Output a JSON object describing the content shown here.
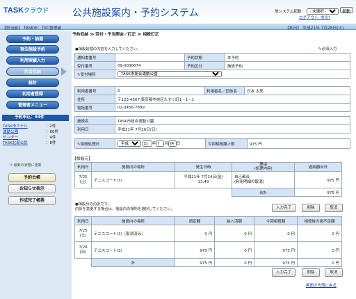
{
  "header": {
    "logo_main": "TASK",
    "logo_sub": "クラウド",
    "app_title": "公共施設案内・予約システム",
    "system_label": "他システム起動：",
    "system_select": "- 未選択 -",
    "launch": "起動",
    "logout": "ログアウト",
    "help": "市の?"
  },
  "topbar": {
    "left": "【担当者】 TASK市：TKC管理者",
    "right": "【本日】 平成21年 7月28日(火)"
  },
  "breadcrumb": "予約収納 ≫ 受付・予当照会／訂正 ≫ 相殺訂正",
  "nav": [
    "予約・抽選",
    "宿泊施設予約",
    "利用実績入力",
    "料金収納",
    "統計",
    "利用者登録",
    "管理者メニュー"
  ],
  "summary": {
    "title": "予約申込：94件",
    "items": [
      {
        "name": "TASK市ホテル",
        "count": "：2件"
      },
      {
        "name": "運動公園",
        "count": "：80件"
      },
      {
        "name": "センター",
        "count": "：4件"
      },
      {
        "name": "TASK北部公民",
        "count": "：8件"
      }
    ]
  },
  "refresh": "最新の状態に更新",
  "side_buttons": [
    "予約台帳",
    "お知らせ表示",
    "作成完了帳票"
  ],
  "hint1": "●相殺処理の内容を入力してください。",
  "required": "必須入力",
  "form": {
    "l_notice": "通知書番号",
    "l_status": "予約状態",
    "v_status": "本予約",
    "l_receipt": "受付番号",
    "v_receipt": "09-0000074",
    "l_kind": "予約区分",
    "v_kind": "施設予約",
    "l_place": "受付場所",
    "v_place": "TASK市総合運動公園"
  },
  "user": {
    "l_no": "利用者番号",
    "v_no": "2",
    "l_name": "利用者名／団体名",
    "v_name": "日本 太郎",
    "l_addr": "住所",
    "v_addr": "〒123-4567 東京都中央区たすく町1－1－1",
    "l_tel": "電話番号",
    "v_tel": "02-3456-7899"
  },
  "facility": {
    "l_name": "施設名",
    "v_name": "TASK市総合運動公園",
    "l_date": "利用日",
    "v_date": "平成21年 7月26日(日)"
  },
  "offset": {
    "l_date": "相殺処理日",
    "era": "平成",
    "y": "21",
    "y_unit": "年",
    "m": "7",
    "m_unit": "月",
    "d": "24",
    "d_unit": "日",
    "l_limit": "今回相殺額上限",
    "v_limit": "975 円"
  },
  "source": {
    "title": "【相殺元】",
    "headers": [
      "利用日",
      "施設内の場所",
      "発生日時",
      "理由\n(処理内容)",
      "過納額合計"
    ],
    "row": {
      "date": "7/25\n(土)",
      "place": "テニスコート(3)",
      "when": "平成21年 7月24日(金)\n13:49",
      "reason": "自己都合\n(利用明細の取消)",
      "amount": "975 円"
    },
    "total_label": "合計",
    "total": "975 円"
  },
  "hint2": "●相殺分の内訳です。\n内訳を変更する場合は、施設内の場所を選択してください。",
  "buttons": {
    "done": "入力完了",
    "delete": "削除",
    "cancel": "取消"
  },
  "target": {
    "headers": [
      "利用日",
      "施設内の場所",
      "調定額",
      "納入済額",
      "今回相殺額",
      "相殺後の過不足額"
    ],
    "rows": [
      {
        "date": "7/25\n(土)",
        "place": "テニスコート(3)［取消済み］",
        "a": "0 円",
        "b": "0 円",
        "c": "0 円",
        "d": "0 円"
      },
      {
        "date": "7/26\n(日)",
        "place": "テニスコート(3)",
        "a": "975 円",
        "b": "0 円",
        "c": "975 円",
        "d": "0 円"
      }
    ],
    "total_label": "計",
    "total": {
      "a": "975 円",
      "b": "0 円",
      "c": "975 円",
      "d": "0 円"
    }
  },
  "back_top": "画面の先頭に戻る"
}
